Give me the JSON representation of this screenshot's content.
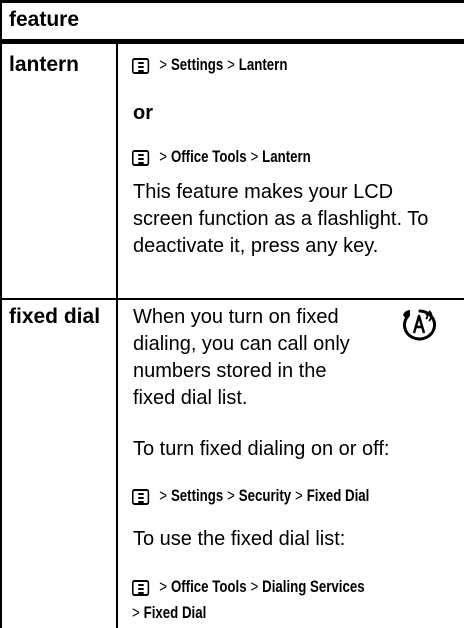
{
  "header": {
    "feature_label": "feature"
  },
  "rows": {
    "lantern": {
      "name": "lantern",
      "path1": {
        "items": [
          "Settings",
          "Lantern"
        ]
      },
      "or_label": "or",
      "path2": {
        "items": [
          "Office Tools",
          "Lantern"
        ]
      },
      "description": "This feature makes your LCD screen function as a flashlight. To deactivate it, press any key."
    },
    "fixed_dial": {
      "name": "fixed dial",
      "intro": "When you turn on fixed dialing, you can call only numbers stored in the fixed dial list.",
      "toggle_text": "To turn fixed dialing on or off:",
      "path1": {
        "items": [
          "Settings",
          "Security",
          "Fixed Dial"
        ]
      },
      "use_text": "To use the fixed dial list:",
      "path2": {
        "line1": [
          "Office Tools",
          "Dialing Services"
        ],
        "line2": [
          "Fixed Dial"
        ]
      }
    }
  },
  "icons": {
    "menu_key": "menu-key-icon",
    "network_feature": "network-feature-icon"
  },
  "separator": ">"
}
